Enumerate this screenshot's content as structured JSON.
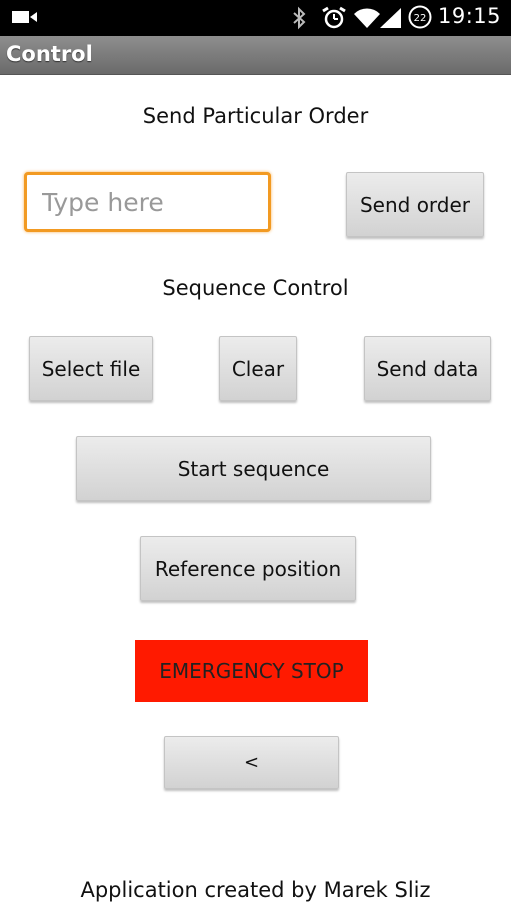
{
  "status_bar": {
    "time": "19:15",
    "notification_count": "22",
    "icons": [
      "video-camera-icon",
      "bluetooth-icon",
      "alarm-icon",
      "wifi-icon",
      "cell-signal-icon",
      "battery-icon"
    ]
  },
  "app_bar": {
    "title": "Control",
    "color": "#7a7a7a"
  },
  "order_section": {
    "heading": "Send Particular Order",
    "input_value": "",
    "input_placeholder": "Type here",
    "send_button_label": "Send order"
  },
  "sequence_section": {
    "heading": "Sequence Control",
    "select_file_label": "Select file",
    "clear_label": "Clear",
    "send_data_label": "Send data",
    "start_sequence_label": "Start sequence",
    "reference_position_label": "Reference position",
    "emergency_stop_label": "EMERGENCY STOP",
    "emergency_color": "#ff1a00",
    "back_label": "<"
  },
  "footer": {
    "text": "Application created by Marek Sliz"
  },
  "colors": {
    "input_focus_border": "#f29a22",
    "button_face": "#dcdcdc"
  }
}
